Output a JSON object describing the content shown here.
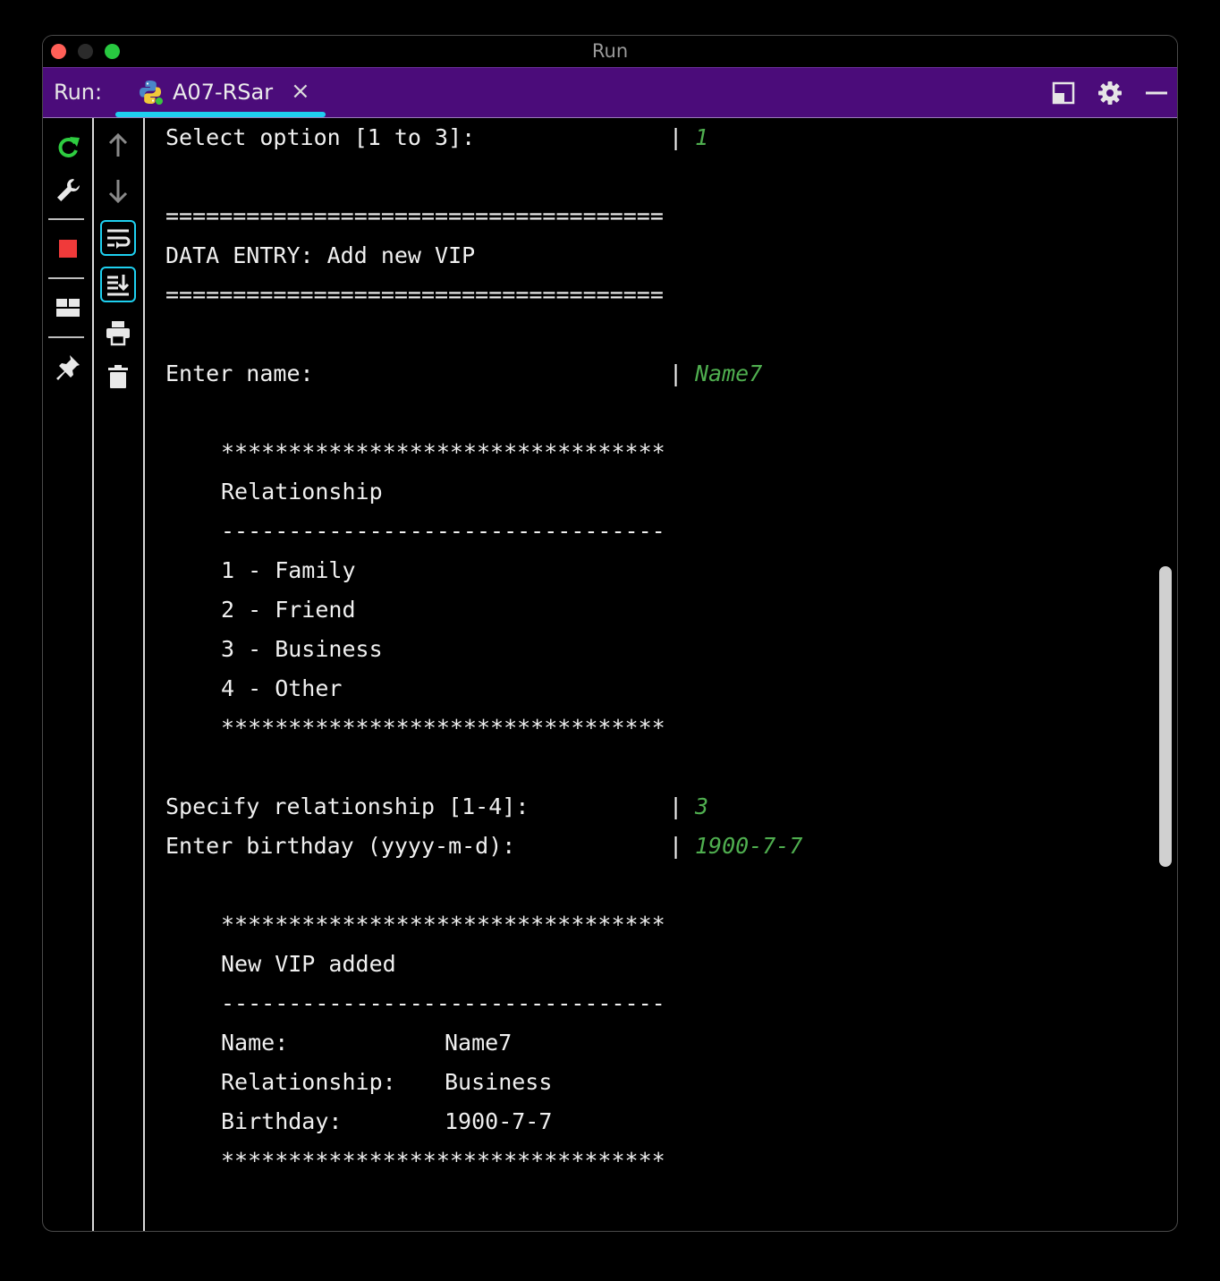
{
  "window": {
    "title": "Run"
  },
  "runbar": {
    "label": "Run:",
    "tab_title": "A07-RSar",
    "tab_close": "×",
    "accent": "#4b0c7a",
    "tab_underline": "#1ed0f0"
  },
  "icons": {
    "toolbar_left": [
      "rerun-icon",
      "wrench-icon",
      "stop-icon",
      "layout-icon",
      "pin-icon"
    ],
    "toolbar_right": [
      "arrow-up-icon",
      "arrow-down-icon",
      "soft-wrap-icon",
      "scroll-to-end-icon",
      "print-icon",
      "trash-icon"
    ],
    "runbar_right": [
      "panel-layout-icon",
      "gear-icon",
      "minimize-icon"
    ]
  },
  "console": {
    "select_prompt": "Select option [1 to 3]:",
    "select_value": "1",
    "rule_eq": "=====================================",
    "header": "DATA ENTRY: Add new VIP",
    "name_prompt": "Enter name:",
    "name_value": "Name7",
    "rule_star": "*********************************",
    "rel_title": "Relationship",
    "rule_dash": "---------------------------------",
    "options": [
      "1 - Family",
      "2 - Friend",
      "3 - Business",
      "4 - Other"
    ],
    "rel_prompt": "Specify relationship [1-4]:",
    "rel_value": "3",
    "bday_prompt": "Enter birthday (yyyy-m-d):",
    "bday_value": "1900-7-7",
    "added_title": "New VIP added",
    "summary": [
      {
        "label": "Name:",
        "value": "Name7"
      },
      {
        "label": "Relationship:",
        "value": "Business"
      },
      {
        "label": "Birthday:",
        "value": "1900-7-7"
      }
    ],
    "separator": "|",
    "input_color": "#4fae4f"
  }
}
